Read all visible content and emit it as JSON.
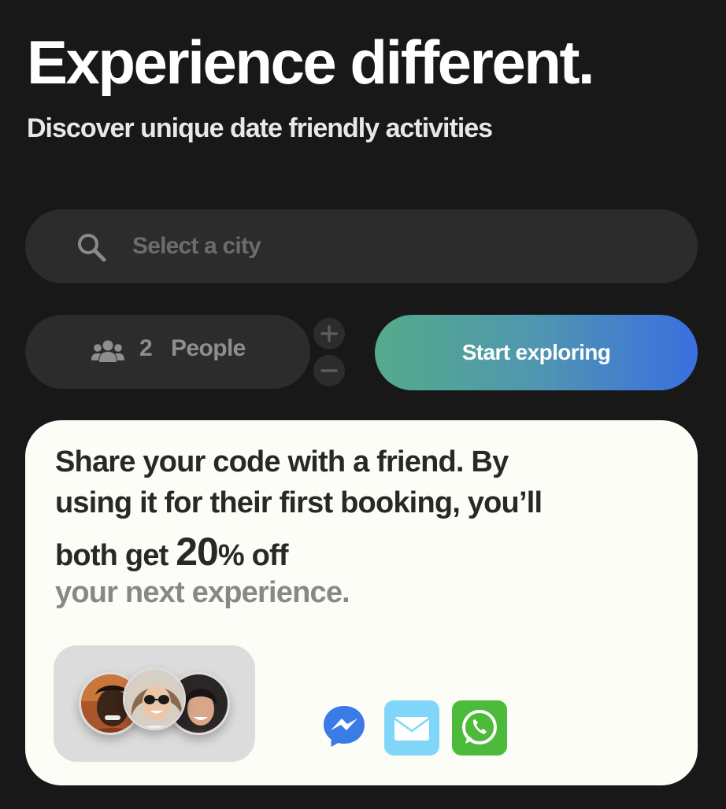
{
  "hero": {
    "title": "Experience different.",
    "subtitle": "Discover unique date friendly activities"
  },
  "search": {
    "placeholder": "Select a city",
    "icon": "search-icon"
  },
  "people": {
    "icon": "group-icon",
    "count": "2",
    "label": "People",
    "increment_icon": "plus-icon",
    "decrement_icon": "minus-icon"
  },
  "cta": {
    "label": "Start exploring",
    "gradient": [
      "#54ab8a",
      "#3a6fe0"
    ]
  },
  "referral": {
    "line1": "Share your code with a friend. By",
    "line2": "using it for their first booking, you’ll",
    "line3_prefix": "both get ",
    "discount_number": "20",
    "discount_suffix": "% off",
    "line4": "your next experience.",
    "avatars": [
      "avatar-friend-1",
      "avatar-friend-2",
      "avatar-friend-3"
    ],
    "share_options": [
      "messenger-icon",
      "mail-icon",
      "whatsapp-icon"
    ]
  },
  "colors": {
    "background": "#181818",
    "field": "#2c2c2c",
    "card": "#fcfdf6",
    "muted_text": "#888888"
  }
}
